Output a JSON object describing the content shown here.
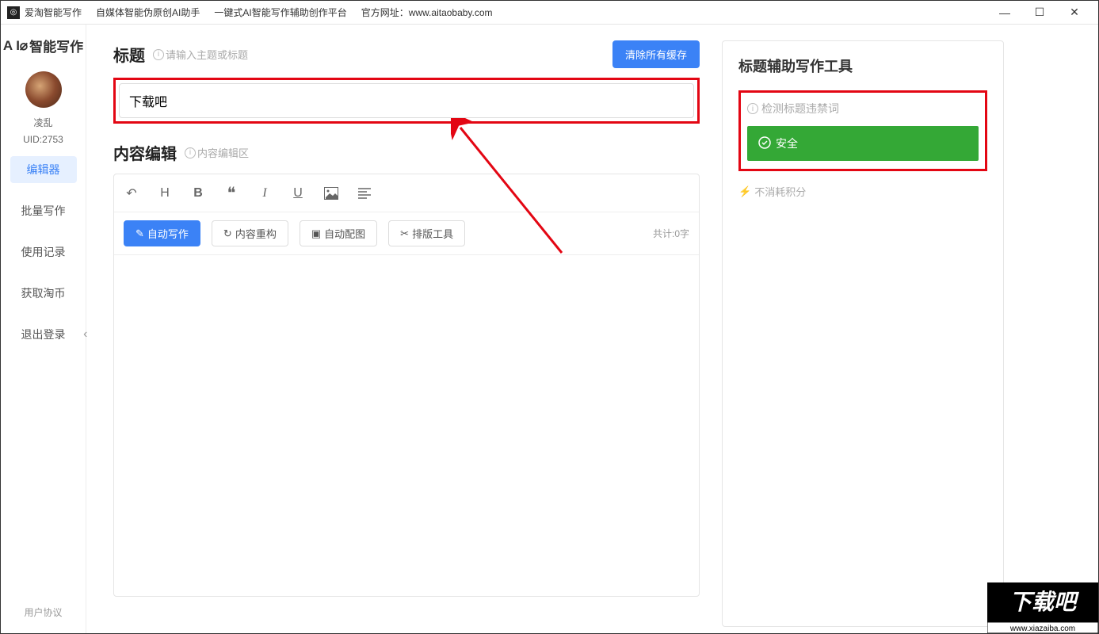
{
  "titlebar": {
    "app_name": "爱淘智能写作",
    "tagline1": "自媒体智能伪原创AI助手",
    "tagline2": "一键式AI智能写作辅助创作平台",
    "website_label": "官方网址：",
    "website_url": "www.aitaobaby.com"
  },
  "sidebar": {
    "logo": "智能写作",
    "username": "凌乱",
    "uid": "UID:2753",
    "nav": [
      {
        "label": "编辑器",
        "active": true
      },
      {
        "label": "批量写作",
        "active": false
      },
      {
        "label": "使用记录",
        "active": false
      },
      {
        "label": "获取淘币",
        "active": false
      },
      {
        "label": "退出登录",
        "active": false
      }
    ],
    "footer": "用户协议"
  },
  "main": {
    "title_section": {
      "label": "标题",
      "hint": "请输入主题或标题",
      "clear_btn": "清除所有缓存",
      "input_value": "下载吧"
    },
    "content_section": {
      "label": "内容编辑",
      "hint": "内容编辑区"
    },
    "actions": {
      "auto_write": "自动写作",
      "restructure": "内容重构",
      "auto_image": "自动配图",
      "layout_tool": "排版工具"
    },
    "word_count": "共计:0字"
  },
  "right": {
    "title": "标题辅助写作工具",
    "check_label": "检测标题违禁词",
    "safe_label": "安全",
    "points_hint": "不消耗积分"
  },
  "watermark": {
    "text": "下载吧",
    "url": "www.xiazaiba.com"
  }
}
